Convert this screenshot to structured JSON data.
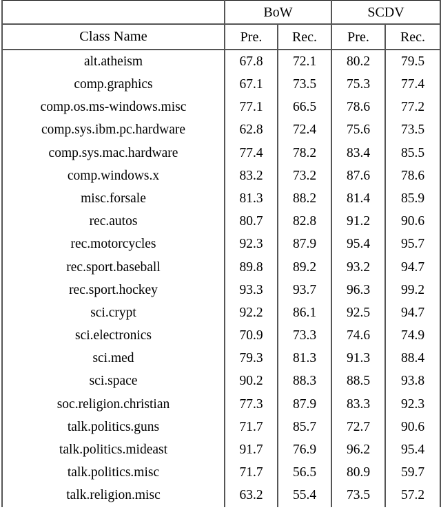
{
  "table": {
    "column_groups": [
      {
        "label": "",
        "span": 1
      },
      {
        "label": "BoW",
        "span": 2
      },
      {
        "label": "SCDV",
        "span": 2
      }
    ],
    "group_bow_label": "BoW",
    "group_scdv_label": "SCDV",
    "headers": {
      "class_name": "Class Name",
      "bow_precision": "Pre.",
      "bow_recall": "Rec.",
      "scdv_precision": "Pre.",
      "scdv_recall": "Rec."
    },
    "rows": [
      {
        "class_name": "alt.atheism",
        "bow_pre": "67.8",
        "bow_rec": "72.1",
        "scdv_pre": "80.2",
        "scdv_rec": "79.5"
      },
      {
        "class_name": "comp.graphics",
        "bow_pre": "67.1",
        "bow_rec": "73.5",
        "scdv_pre": "75.3",
        "scdv_rec": "77.4"
      },
      {
        "class_name": "comp.os.ms-windows.misc",
        "bow_pre": "77.1",
        "bow_rec": "66.5",
        "scdv_pre": "78.6",
        "scdv_rec": "77.2"
      },
      {
        "class_name": "comp.sys.ibm.pc.hardware",
        "bow_pre": "62.8",
        "bow_rec": "72.4",
        "scdv_pre": "75.6",
        "scdv_rec": "73.5"
      },
      {
        "class_name": "comp.sys.mac.hardware",
        "bow_pre": "77.4",
        "bow_rec": "78.2",
        "scdv_pre": "83.4",
        "scdv_rec": "85.5"
      },
      {
        "class_name": "comp.windows.x",
        "bow_pre": "83.2",
        "bow_rec": "73.2",
        "scdv_pre": "87.6",
        "scdv_rec": "78.6"
      },
      {
        "class_name": "misc.forsale",
        "bow_pre": "81.3",
        "bow_rec": "88.2",
        "scdv_pre": "81.4",
        "scdv_rec": "85.9"
      },
      {
        "class_name": "rec.autos",
        "bow_pre": "80.7",
        "bow_rec": "82.8",
        "scdv_pre": "91.2",
        "scdv_rec": "90.6"
      },
      {
        "class_name": "rec.motorcycles",
        "bow_pre": "92.3",
        "bow_rec": "87.9",
        "scdv_pre": "95.4",
        "scdv_rec": "95.7"
      },
      {
        "class_name": "rec.sport.baseball",
        "bow_pre": "89.8",
        "bow_rec": "89.2",
        "scdv_pre": "93.2",
        "scdv_rec": "94.7"
      },
      {
        "class_name": "rec.sport.hockey",
        "bow_pre": "93.3",
        "bow_rec": "93.7",
        "scdv_pre": "96.3",
        "scdv_rec": "99.2"
      },
      {
        "class_name": "sci.crypt",
        "bow_pre": "92.2",
        "bow_rec": "86.1",
        "scdv_pre": "92.5",
        "scdv_rec": "94.7"
      },
      {
        "class_name": "sci.electronics",
        "bow_pre": "70.9",
        "bow_rec": "73.3",
        "scdv_pre": "74.6",
        "scdv_rec": "74.9"
      },
      {
        "class_name": "sci.med",
        "bow_pre": "79.3",
        "bow_rec": "81.3",
        "scdv_pre": "91.3",
        "scdv_rec": "88.4"
      },
      {
        "class_name": "sci.space",
        "bow_pre": "90.2",
        "bow_rec": "88.3",
        "scdv_pre": "88.5",
        "scdv_rec": "93.8"
      },
      {
        "class_name": "soc.religion.christian",
        "bow_pre": "77.3",
        "bow_rec": "87.9",
        "scdv_pre": "83.3",
        "scdv_rec": "92.3"
      },
      {
        "class_name": "talk.politics.guns",
        "bow_pre": "71.7",
        "bow_rec": "85.7",
        "scdv_pre": "72.7",
        "scdv_rec": "90.6"
      },
      {
        "class_name": "talk.politics.mideast",
        "bow_pre": "91.7",
        "bow_rec": "76.9",
        "scdv_pre": "96.2",
        "scdv_rec": "95.4"
      },
      {
        "class_name": "talk.politics.misc",
        "bow_pre": "71.7",
        "bow_rec": "56.5",
        "scdv_pre": "80.9",
        "scdv_rec": "59.7"
      },
      {
        "class_name": "talk.religion.misc",
        "bow_pre": "63.2",
        "bow_rec": "55.4",
        "scdv_pre": "73.5",
        "scdv_rec": "57.2"
      }
    ]
  },
  "chart_data": {
    "type": "table",
    "title": "",
    "categories": [
      "alt.atheism",
      "comp.graphics",
      "comp.os.ms-windows.misc",
      "comp.sys.ibm.pc.hardware",
      "comp.sys.mac.hardware",
      "comp.windows.x",
      "misc.forsale",
      "rec.autos",
      "rec.motorcycles",
      "rec.sport.baseball",
      "rec.sport.hockey",
      "sci.crypt",
      "sci.electronics",
      "sci.med",
      "sci.space",
      "soc.religion.christian",
      "talk.politics.guns",
      "talk.politics.mideast",
      "talk.politics.misc",
      "talk.religion.misc"
    ],
    "series": [
      {
        "name": "BoW Pre.",
        "values": [
          67.8,
          67.1,
          77.1,
          62.8,
          77.4,
          83.2,
          81.3,
          80.7,
          92.3,
          89.8,
          93.3,
          92.2,
          70.9,
          79.3,
          90.2,
          77.3,
          71.7,
          91.7,
          71.7,
          63.2
        ]
      },
      {
        "name": "BoW Rec.",
        "values": [
          72.1,
          73.5,
          66.5,
          72.4,
          78.2,
          73.2,
          88.2,
          82.8,
          87.9,
          89.2,
          93.7,
          86.1,
          73.3,
          81.3,
          88.3,
          87.9,
          85.7,
          76.9,
          56.5,
          55.4
        ]
      },
      {
        "name": "SCDV Pre.",
        "values": [
          80.2,
          75.3,
          78.6,
          75.6,
          83.4,
          87.6,
          81.4,
          91.2,
          95.4,
          93.2,
          96.3,
          92.5,
          74.6,
          91.3,
          88.5,
          83.3,
          72.7,
          96.2,
          80.9,
          73.5
        ]
      },
      {
        "name": "SCDV Rec.",
        "values": [
          79.5,
          77.4,
          77.2,
          73.5,
          85.5,
          78.6,
          85.9,
          90.6,
          95.7,
          94.7,
          99.2,
          94.7,
          74.9,
          88.4,
          93.8,
          92.3,
          90.6,
          95.4,
          59.7,
          57.2
        ]
      }
    ],
    "xlabel": "Class Name",
    "ylabel": "",
    "grid": true,
    "legend": "none"
  }
}
